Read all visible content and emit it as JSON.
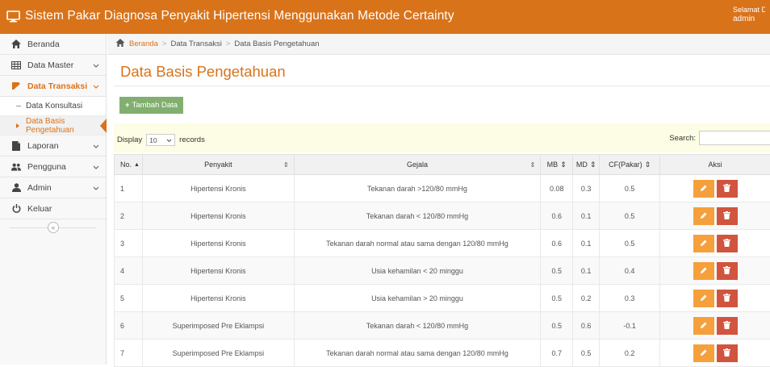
{
  "app": {
    "title": "Sistem Pakar Diagnosa Penyakit Hipertensi Menggunakan Metode Certainty",
    "greeting": "Selamat Datang,",
    "username": "admin"
  },
  "sidebar": {
    "items": [
      {
        "label": "Beranda",
        "icon": "home-icon"
      },
      {
        "label": "Data Master",
        "icon": "table-icon"
      },
      {
        "label": "Data Transaksi",
        "icon": "book-icon"
      },
      {
        "label": "Laporan",
        "icon": "file-icon"
      },
      {
        "label": "Pengguna",
        "icon": "users-icon"
      },
      {
        "label": "Admin",
        "icon": "user-icon"
      },
      {
        "label": "Keluar",
        "icon": "power-icon"
      }
    ],
    "sub_items": [
      {
        "label": "Data Konsultasi"
      },
      {
        "label": "Data Basis Pengetahuan"
      }
    ],
    "collapse_icon": "double-chevron-left-icon"
  },
  "breadcrumb": {
    "home": "Beranda",
    "section": "Data Transaksi",
    "current": "Data Basis Pengetahuan"
  },
  "page": {
    "title": "Data Basis Pengetahuan",
    "add_button": "Tambah Data",
    "display_label": "Display",
    "display_value": "10",
    "records_label": "records",
    "search_label": "Search:"
  },
  "table": {
    "headers": {
      "no": "No.",
      "penyakit": "Penyakit",
      "gejala": "Gejala",
      "mb": "MB",
      "md": "MD",
      "cf": "CF(Pakar)",
      "aksi": "Aksi"
    },
    "rows": [
      {
        "no": "1",
        "penyakit": "Hipertensi Kronis",
        "gejala": "Tekanan darah >120/80 mmHg",
        "mb": "0.08",
        "md": "0.3",
        "cf": "0.5"
      },
      {
        "no": "2",
        "penyakit": "Hipertensi Kronis",
        "gejala": "Tekanan darah < 120/80 mmHg",
        "mb": "0.6",
        "md": "0.1",
        "cf": "0.5"
      },
      {
        "no": "3",
        "penyakit": "Hipertensi Kronis",
        "gejala": "Tekanan darah normal atau sama dengan 120/80 mmHg",
        "mb": "0.6",
        "md": "0.1",
        "cf": "0.5"
      },
      {
        "no": "4",
        "penyakit": "Hipertensi Kronis",
        "gejala": "Usia kehamilan < 20 minggu",
        "mb": "0.5",
        "md": "0.1",
        "cf": "0.4"
      },
      {
        "no": "5",
        "penyakit": "Hipertensi Kronis",
        "gejala": "Usia kehamilan > 20 minggu",
        "mb": "0.5",
        "md": "0.2",
        "cf": "0.3"
      },
      {
        "no": "6",
        "penyakit": "Superimposed Pre Eklampsi",
        "gejala": "Tekanan darah < 120/80 mmHg",
        "mb": "0.5",
        "md": "0.6",
        "cf": "-0.1"
      },
      {
        "no": "7",
        "penyakit": "Superimposed Pre Eklampsi",
        "gejala": "Tekanan darah normal atau sama dengan 120/80 mmHg",
        "mb": "0.7",
        "md": "0.5",
        "cf": "0.2"
      }
    ]
  },
  "colors": {
    "brand": "#d9731a",
    "add_button": "#82af6f",
    "edit_button": "#f5a03c",
    "delete_button": "#d1543f",
    "filter_bg": "#fcfde4"
  }
}
